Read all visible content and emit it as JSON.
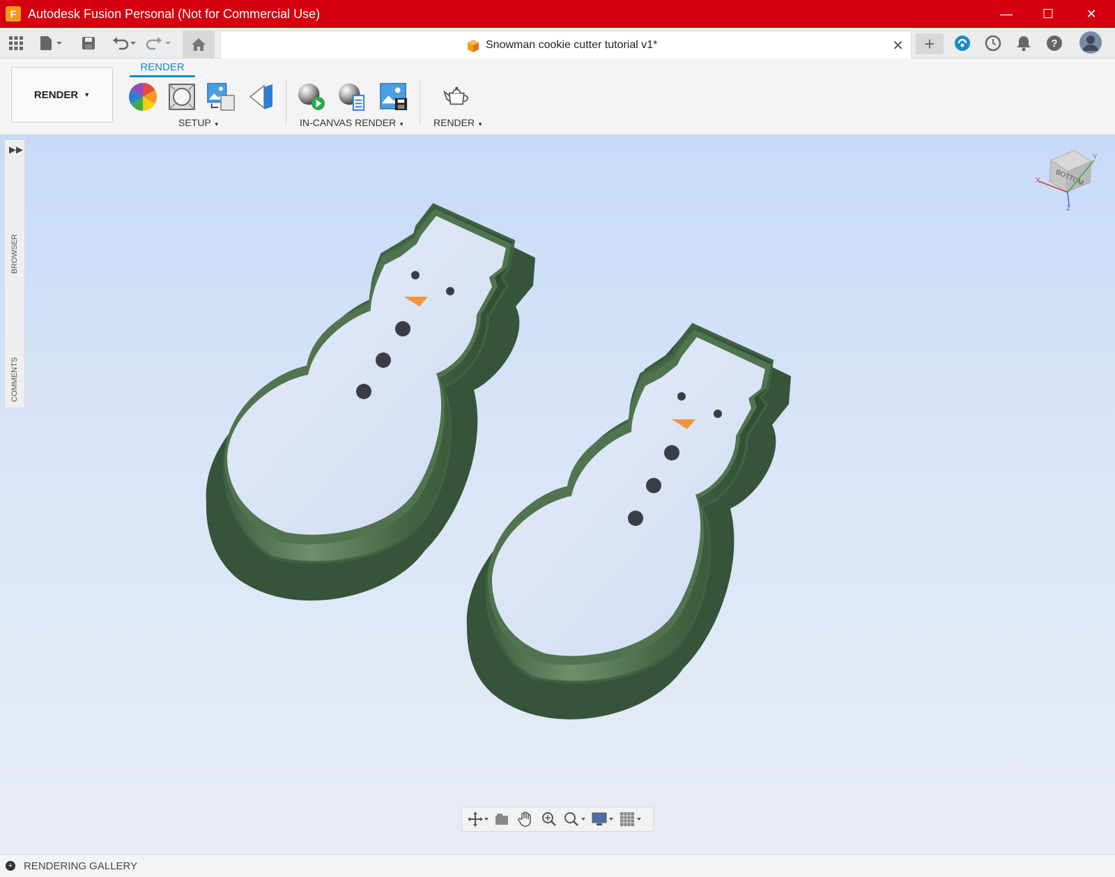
{
  "window": {
    "app_title": "Autodesk Fusion Personal (Not for Commercial Use)",
    "minimize": "—",
    "maximize": "☐",
    "close": "✕"
  },
  "tabs": {
    "document_title": "Snowman cookie cutter tutorial v1*",
    "close_symbol": "✕",
    "new_tab": "+"
  },
  "ribbon": {
    "workspace_label": "RENDER",
    "active_tab": "RENDER",
    "groups": {
      "setup": "SETUP",
      "in_canvas": "IN-CANVAS RENDER",
      "render": "RENDER"
    }
  },
  "side_panel": {
    "browser": "BROWSER",
    "comments": "COMMENTS"
  },
  "viewcube": {
    "face": "BOTTOM",
    "axis_x": "X",
    "axis_y": "Y",
    "axis_z": "Z"
  },
  "bottom": {
    "gallery_label": "RENDERING GALLERY"
  },
  "colors": {
    "title_bar": "#d4000f",
    "accent": "#1a8ac4",
    "cutter_green": "#4b6d4b",
    "cutter_top": "#dde5f5",
    "nose_orange": "#f0953c"
  }
}
